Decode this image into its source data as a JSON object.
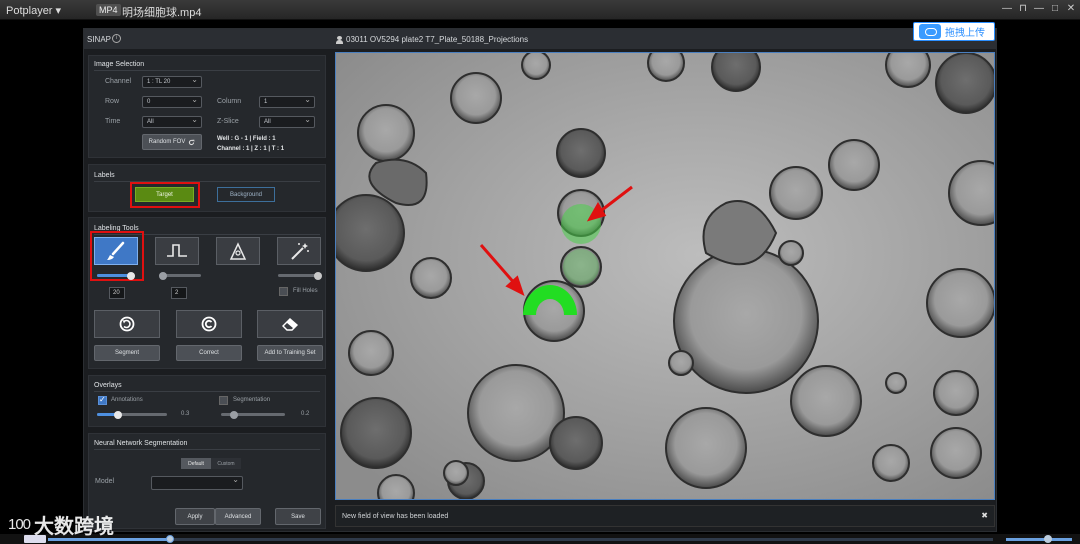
{
  "player": {
    "menu_label": "Potplayer ▾",
    "format_badge": "MP4",
    "file_name": "明场细胞球.mp4",
    "window_controls": [
      "—",
      "⊓",
      "—",
      "□",
      "✕"
    ]
  },
  "app": {
    "title": "SINAP",
    "info_glyph": "i",
    "image_title": "03011 OV5294 plate2 T7_Plate_50188_Projections",
    "upload_button": "拖拽上传"
  },
  "image_selection": {
    "title": "Image Selection",
    "channel_label": "Channel",
    "channel_value": "1 : TL 20",
    "row_label": "Row",
    "row_value": "0",
    "column_label": "Column",
    "column_value": "1",
    "time_label": "Time",
    "time_value": "All",
    "zslice_label": "Z-Slice",
    "zslice_value": "All",
    "random_fov_label": "Random FOV",
    "well_line": "Well : G - 1 |   Field : 1",
    "channel_line": "Channel : 1 | Z : 1   | T : 1"
  },
  "labels": {
    "title": "Labels",
    "target": "Target",
    "background": "Background"
  },
  "labeling_tools": {
    "title": "Labeling Tools",
    "brush_size": "20",
    "smooth_value": "2",
    "fill_holes": "Fill Holes",
    "segment": "Segment",
    "correct": "Correct",
    "add_training": "Add to Training Set",
    "brush_level": 0.9,
    "threshold_level": 0.1
  },
  "overlays": {
    "title": "Overlays",
    "annotations_label": "Annotations",
    "annotations_checked": true,
    "annotations_value": "0.3",
    "annotations_level": 0.3,
    "segmentation_label": "Segmentation",
    "segmentation_checked": false,
    "segmentation_value": "0.2",
    "segmentation_level": 0.2
  },
  "nn": {
    "title": "Neural Network Segmentation",
    "toggle_default": "Default",
    "toggle_custom": "Custom",
    "model_label": "Model",
    "model_value": "",
    "apply": "Apply",
    "advanced": "Advanced",
    "save": "Save"
  },
  "status": {
    "message": "New field of view has been loaded",
    "close": "✖"
  },
  "watermark": {
    "logo": "100",
    "text": "大数跨境"
  },
  "colors": {
    "accent_blue": "#3f78c6",
    "target_green": "#5a8a12",
    "highlight_red": "#e01010",
    "mask_green": "#3ee03e"
  }
}
